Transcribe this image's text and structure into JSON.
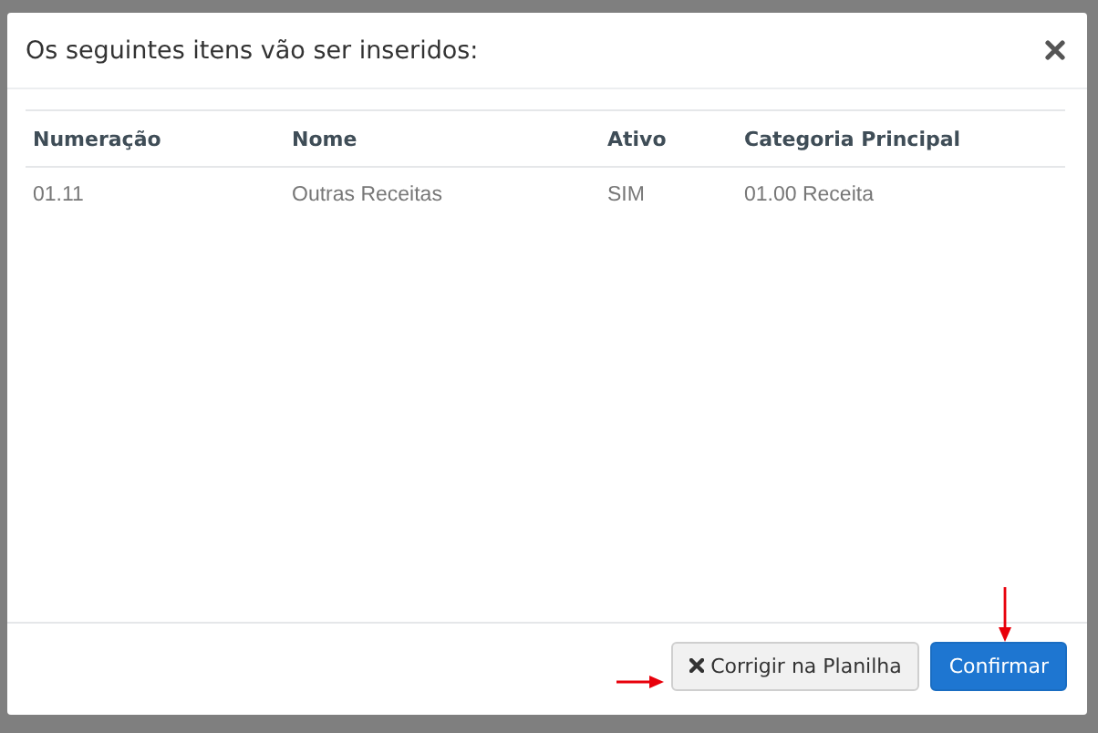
{
  "modal": {
    "title": "Os seguintes itens vão ser inseridos:"
  },
  "table": {
    "columns": [
      "Numeração",
      "Nome",
      "Ativo",
      "Categoria Principal"
    ],
    "rows": [
      [
        "01.11",
        "Outras Receitas",
        "SIM",
        "01.00 Receita"
      ]
    ]
  },
  "buttons": [
    {
      "label": "Corrigir na Planilha",
      "kind": "secondary"
    },
    {
      "label": "Confirmar",
      "kind": "primary"
    }
  ]
}
